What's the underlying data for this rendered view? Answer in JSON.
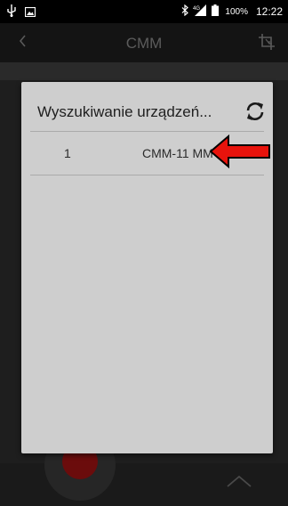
{
  "status_bar": {
    "network": "4G",
    "battery": "100%",
    "time": "12:22"
  },
  "app_bar": {
    "title": "CMM"
  },
  "dialog": {
    "title": "Wyszukiwanie urządzeń...",
    "devices": [
      {
        "index": "1",
        "name": "CMM-11 MM"
      }
    ]
  },
  "colors": {
    "annotation_arrow": "#e8130c",
    "record_button": "#6b0c0c",
    "dialog_background": "#cecece"
  }
}
